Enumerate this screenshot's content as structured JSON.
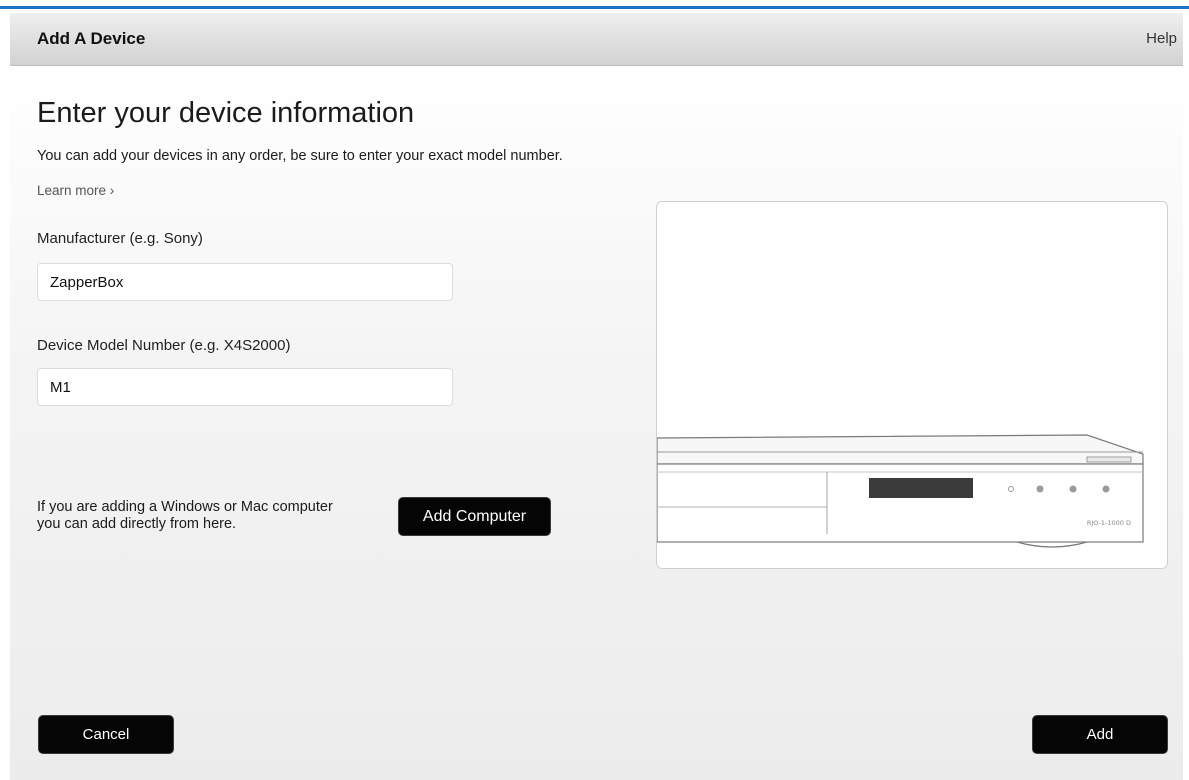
{
  "window": {
    "title": "Add A Device",
    "help_label": "Help"
  },
  "main": {
    "heading": "Enter your device information",
    "intro": "You can add your devices in any order, be sure to enter your exact model number.",
    "learn_more": "Learn more ›"
  },
  "form": {
    "manufacturer": {
      "label": "Manufacturer   (e.g. Sony)",
      "value": "ZapperBox"
    },
    "model": {
      "label": "Device Model Number  (e.g. X4S2000)",
      "value": "M1"
    }
  },
  "computer": {
    "note": "If you are adding a Windows or Mac computer you can add directly from here.",
    "button_label": "Add Computer"
  },
  "device_image": {
    "icon": "set-top-box-illustration",
    "model_text": "RJO-1-1000 D"
  },
  "footer": {
    "cancel_label": "Cancel",
    "add_label": "Add"
  },
  "colors": {
    "accent_line": "#1a73c7",
    "button_bg": "#050505",
    "titlebar": "#d9d9d9"
  }
}
